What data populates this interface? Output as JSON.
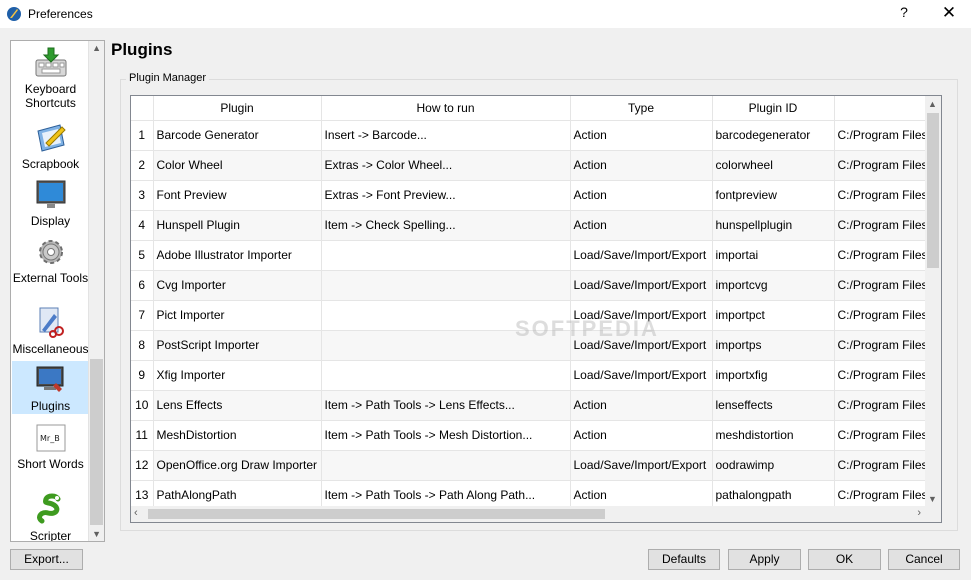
{
  "window": {
    "title": "Preferences",
    "help": "?",
    "close": "✕"
  },
  "sidebar": {
    "items": [
      {
        "label": "Keyboard Shortcuts",
        "icon": "keyboard-icon"
      },
      {
        "label": "Scrapbook",
        "icon": "scrapbook-icon"
      },
      {
        "label": "Display",
        "icon": "display-icon"
      },
      {
        "label": "External Tools",
        "icon": "gear-icon"
      },
      {
        "label": "Miscellaneous",
        "icon": "miscellaneous-icon"
      },
      {
        "label": "Plugins",
        "icon": "plugin-icon",
        "selected": true
      },
      {
        "label": "Short Words",
        "icon": "short-words-icon"
      },
      {
        "label": "Scripter",
        "icon": "python-icon"
      }
    ]
  },
  "main": {
    "heading": "Plugins",
    "group_label": "Plugin Manager",
    "columns": [
      "Plugin",
      "How to run",
      "Type",
      "Plugin ID",
      ""
    ],
    "rows": [
      {
        "num": "1",
        "plugin": "Barcode Generator",
        "how": "Insert -> Barcode...",
        "type": "Action",
        "id": "barcodegenerator",
        "file": "C:/Program Files"
      },
      {
        "num": "2",
        "plugin": "Color Wheel",
        "how": "Extras -> Color Wheel...",
        "type": "Action",
        "id": "colorwheel",
        "file": "C:/Program Files"
      },
      {
        "num": "3",
        "plugin": "Font Preview",
        "how": "Extras -> Font Preview...",
        "type": "Action",
        "id": "fontpreview",
        "file": "C:/Program Files"
      },
      {
        "num": "4",
        "plugin": "Hunspell Plugin",
        "how": "Item -> Check Spelling...",
        "type": "Action",
        "id": "hunspellplugin",
        "file": "C:/Program Files"
      },
      {
        "num": "5",
        "plugin": "Adobe Illustrator Importer",
        "how": "",
        "type": "Load/Save/Import/Export",
        "id": "importai",
        "file": "C:/Program Files"
      },
      {
        "num": "6",
        "plugin": "Cvg Importer",
        "how": "",
        "type": "Load/Save/Import/Export",
        "id": "importcvg",
        "file": "C:/Program Files"
      },
      {
        "num": "7",
        "plugin": "Pict Importer",
        "how": "",
        "type": "Load/Save/Import/Export",
        "id": "importpct",
        "file": "C:/Program Files"
      },
      {
        "num": "8",
        "plugin": "PostScript Importer",
        "how": "",
        "type": "Load/Save/Import/Export",
        "id": "importps",
        "file": "C:/Program Files"
      },
      {
        "num": "9",
        "plugin": "Xfig Importer",
        "how": "",
        "type": "Load/Save/Import/Export",
        "id": "importxfig",
        "file": "C:/Program Files"
      },
      {
        "num": "10",
        "plugin": "Lens Effects",
        "how": "Item -> Path Tools -> Lens Effects...",
        "type": "Action",
        "id": "lenseffects",
        "file": "C:/Program Files"
      },
      {
        "num": "11",
        "plugin": "MeshDistortion",
        "how": "Item -> Path Tools -> Mesh Distortion...",
        "type": "Action",
        "id": "meshdistortion",
        "file": "C:/Program Files"
      },
      {
        "num": "12",
        "plugin": "OpenOffice.org Draw Importer",
        "how": "",
        "type": "Load/Save/Import/Export",
        "id": "oodrawimp",
        "file": "C:/Program Files"
      },
      {
        "num": "13",
        "plugin": "PathAlongPath",
        "how": "Item -> Path Tools -> Path Along Path...",
        "type": "Action",
        "id": "pathalongpath",
        "file": "C:/Program Files"
      }
    ],
    "watermark": "SOFTPEDIA"
  },
  "buttons": {
    "export": "Export...",
    "defaults": "Defaults",
    "apply": "Apply",
    "ok": "OK",
    "cancel": "Cancel"
  }
}
